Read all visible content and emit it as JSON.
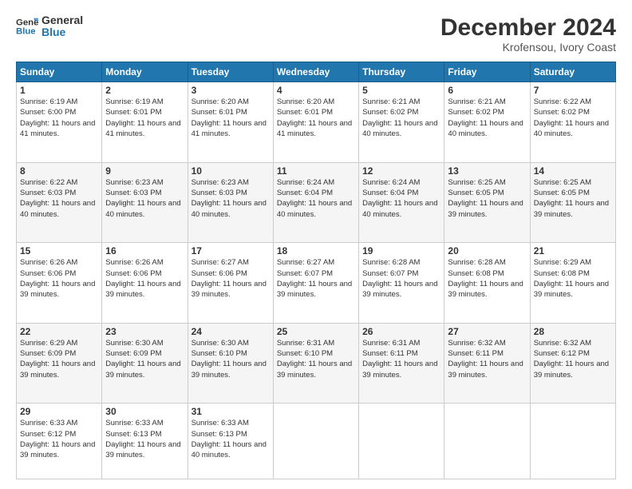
{
  "header": {
    "logo_line1": "General",
    "logo_line2": "Blue",
    "main_title": "December 2024",
    "subtitle": "Krofensou, Ivory Coast"
  },
  "columns": [
    "Sunday",
    "Monday",
    "Tuesday",
    "Wednesday",
    "Thursday",
    "Friday",
    "Saturday"
  ],
  "weeks": [
    [
      {
        "day": "1",
        "sunrise": "6:19 AM",
        "sunset": "6:00 PM",
        "daylight": "11 hours and 41 minutes."
      },
      {
        "day": "2",
        "sunrise": "6:19 AM",
        "sunset": "6:01 PM",
        "daylight": "11 hours and 41 minutes."
      },
      {
        "day": "3",
        "sunrise": "6:20 AM",
        "sunset": "6:01 PM",
        "daylight": "11 hours and 41 minutes."
      },
      {
        "day": "4",
        "sunrise": "6:20 AM",
        "sunset": "6:01 PM",
        "daylight": "11 hours and 41 minutes."
      },
      {
        "day": "5",
        "sunrise": "6:21 AM",
        "sunset": "6:02 PM",
        "daylight": "11 hours and 40 minutes."
      },
      {
        "day": "6",
        "sunrise": "6:21 AM",
        "sunset": "6:02 PM",
        "daylight": "11 hours and 40 minutes."
      },
      {
        "day": "7",
        "sunrise": "6:22 AM",
        "sunset": "6:02 PM",
        "daylight": "11 hours and 40 minutes."
      }
    ],
    [
      {
        "day": "8",
        "sunrise": "6:22 AM",
        "sunset": "6:03 PM",
        "daylight": "11 hours and 40 minutes."
      },
      {
        "day": "9",
        "sunrise": "6:23 AM",
        "sunset": "6:03 PM",
        "daylight": "11 hours and 40 minutes."
      },
      {
        "day": "10",
        "sunrise": "6:23 AM",
        "sunset": "6:03 PM",
        "daylight": "11 hours and 40 minutes."
      },
      {
        "day": "11",
        "sunrise": "6:24 AM",
        "sunset": "6:04 PM",
        "daylight": "11 hours and 40 minutes."
      },
      {
        "day": "12",
        "sunrise": "6:24 AM",
        "sunset": "6:04 PM",
        "daylight": "11 hours and 40 minutes."
      },
      {
        "day": "13",
        "sunrise": "6:25 AM",
        "sunset": "6:05 PM",
        "daylight": "11 hours and 39 minutes."
      },
      {
        "day": "14",
        "sunrise": "6:25 AM",
        "sunset": "6:05 PM",
        "daylight": "11 hours and 39 minutes."
      }
    ],
    [
      {
        "day": "15",
        "sunrise": "6:26 AM",
        "sunset": "6:06 PM",
        "daylight": "11 hours and 39 minutes."
      },
      {
        "day": "16",
        "sunrise": "6:26 AM",
        "sunset": "6:06 PM",
        "daylight": "11 hours and 39 minutes."
      },
      {
        "day": "17",
        "sunrise": "6:27 AM",
        "sunset": "6:06 PM",
        "daylight": "11 hours and 39 minutes."
      },
      {
        "day": "18",
        "sunrise": "6:27 AM",
        "sunset": "6:07 PM",
        "daylight": "11 hours and 39 minutes."
      },
      {
        "day": "19",
        "sunrise": "6:28 AM",
        "sunset": "6:07 PM",
        "daylight": "11 hours and 39 minutes."
      },
      {
        "day": "20",
        "sunrise": "6:28 AM",
        "sunset": "6:08 PM",
        "daylight": "11 hours and 39 minutes."
      },
      {
        "day": "21",
        "sunrise": "6:29 AM",
        "sunset": "6:08 PM",
        "daylight": "11 hours and 39 minutes."
      }
    ],
    [
      {
        "day": "22",
        "sunrise": "6:29 AM",
        "sunset": "6:09 PM",
        "daylight": "11 hours and 39 minutes."
      },
      {
        "day": "23",
        "sunrise": "6:30 AM",
        "sunset": "6:09 PM",
        "daylight": "11 hours and 39 minutes."
      },
      {
        "day": "24",
        "sunrise": "6:30 AM",
        "sunset": "6:10 PM",
        "daylight": "11 hours and 39 minutes."
      },
      {
        "day": "25",
        "sunrise": "6:31 AM",
        "sunset": "6:10 PM",
        "daylight": "11 hours and 39 minutes."
      },
      {
        "day": "26",
        "sunrise": "6:31 AM",
        "sunset": "6:11 PM",
        "daylight": "11 hours and 39 minutes."
      },
      {
        "day": "27",
        "sunrise": "6:32 AM",
        "sunset": "6:11 PM",
        "daylight": "11 hours and 39 minutes."
      },
      {
        "day": "28",
        "sunrise": "6:32 AM",
        "sunset": "6:12 PM",
        "daylight": "11 hours and 39 minutes."
      }
    ],
    [
      {
        "day": "29",
        "sunrise": "6:33 AM",
        "sunset": "6:12 PM",
        "daylight": "11 hours and 39 minutes."
      },
      {
        "day": "30",
        "sunrise": "6:33 AM",
        "sunset": "6:13 PM",
        "daylight": "11 hours and 39 minutes."
      },
      {
        "day": "31",
        "sunrise": "6:33 AM",
        "sunset": "6:13 PM",
        "daylight": "11 hours and 40 minutes."
      },
      null,
      null,
      null,
      null
    ]
  ]
}
